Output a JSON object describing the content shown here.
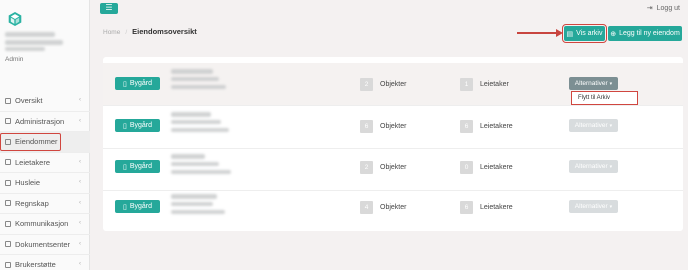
{
  "sidebar": {
    "role_label": "Admin",
    "items": [
      {
        "label": "Oversikt",
        "icon": "home-icon"
      },
      {
        "label": "Administrasjon",
        "icon": "user-icon"
      },
      {
        "label": "Eiendommer",
        "icon": "building-icon",
        "active": true
      },
      {
        "label": "Leietakere",
        "icon": "users-icon"
      },
      {
        "label": "Husleie",
        "icon": "invoice-icon"
      },
      {
        "label": "Regnskap",
        "icon": "ledger-icon"
      },
      {
        "label": "Kommunikasjon",
        "icon": "chat-icon"
      },
      {
        "label": "Dokumentsenter",
        "icon": "document-icon"
      },
      {
        "label": "Brukerstøtte",
        "icon": "support-icon"
      }
    ]
  },
  "topbar": {
    "menu_icon": "☰",
    "logout_label": "Logg ut"
  },
  "breadcrumb": {
    "home": "Home",
    "separator": "/",
    "current": "Eiendomsoversikt"
  },
  "actions": {
    "vis_arkiv": "Vis arkiv",
    "legg_til": "Legg til ny eiendom"
  },
  "properties": [
    {
      "type": "Bygård",
      "objects_count": "2",
      "objects_label": "Objekter",
      "tenants_count": "1",
      "tenants_label": "Leietaker",
      "options_label": "Alternativer",
      "open": true
    },
    {
      "type": "Bygård",
      "objects_count": "6",
      "objects_label": "Objekter",
      "tenants_count": "6",
      "tenants_label": "Leietakere",
      "options_label": "Alternativer"
    },
    {
      "type": "Bygård",
      "objects_count": "2",
      "objects_label": "Objekter",
      "tenants_count": "0",
      "tenants_label": "Leietakere",
      "options_label": "Alternativer"
    },
    {
      "type": "Bygård",
      "objects_count": "4",
      "objects_label": "Objekter",
      "tenants_count": "6",
      "tenants_label": "Leietakere",
      "options_label": "Alternativer"
    }
  ],
  "dropdown": {
    "item": "Flytt til Arkiv"
  },
  "colors": {
    "accent": "#25a89a",
    "highlight": "#d0463f"
  }
}
